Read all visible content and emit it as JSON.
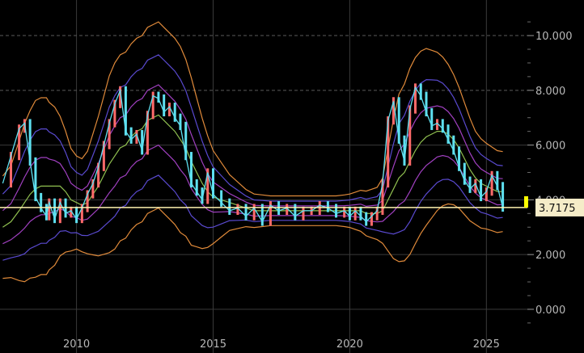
{
  "chart_data": {
    "type": "line",
    "title": "",
    "xlabel": "",
    "ylabel": "",
    "x_ticks": [
      "2010",
      "2015",
      "2020",
      "2025"
    ],
    "y_ticks": [
      "0.000",
      "2.000",
      "4.000",
      "6.000",
      "8.000",
      "10.000"
    ],
    "xlim": [
      2007.2,
      2026.5
    ],
    "ylim": [
      -0.8,
      11.3
    ],
    "grid": true,
    "legend": "none",
    "last_price_label": "3.7175",
    "last_price": 3.7175,
    "colors": {
      "background": "#000000",
      "grid": "#3a3a3a",
      "grid_dashed": "#5a5a5a",
      "price_up": "#ff6a6a",
      "price_line": "#5ee0f0",
      "last_price_line": "#fff2b0",
      "last_price_tag": "#f5ecc8",
      "last_price_marker": "#ffff00",
      "ma_line": "#90c050",
      "band1": "#a040c0",
      "band2": "#5a4ad0",
      "band3": "#e08a3a"
    },
    "series": [
      {
        "role": "price",
        "x": [
          2007.3,
          2007.6,
          2007.9,
          2008.1,
          2008.3,
          2008.5,
          2008.7,
          2008.9,
          2009.0,
          2009.2,
          2009.4,
          2009.6,
          2009.8,
          2010.0,
          2010.2,
          2010.4,
          2010.6,
          2010.8,
          2011.0,
          2011.2,
          2011.4,
          2011.6,
          2011.8,
          2012.0,
          2012.2,
          2012.4,
          2012.6,
          2012.8,
          2013.0,
          2013.2,
          2013.4,
          2013.6,
          2013.8,
          2014.0,
          2014.2,
          2014.4,
          2014.6,
          2014.8,
          2015.0,
          2015.3,
          2015.6,
          2015.9,
          2016.2,
          2016.5,
          2016.8,
          2017.1,
          2017.4,
          2017.7,
          2018.0,
          2018.3,
          2018.6,
          2018.9,
          2019.2,
          2019.5,
          2019.8,
          2020.0,
          2020.2,
          2020.4,
          2020.6,
          2020.8,
          2021.0,
          2021.2,
          2021.4,
          2021.6,
          2021.8,
          2022.0,
          2022.2,
          2022.4,
          2022.6,
          2022.8,
          2023.0,
          2023.2,
          2023.4,
          2023.6,
          2023.8,
          2024.0,
          2024.2,
          2024.4,
          2024.6,
          2024.8,
          2025.0,
          2025.2,
          2025.4,
          2025.6
        ],
        "values": [
          4.6,
          5.6,
          6.6,
          6.8,
          5.4,
          4.1,
          3.7,
          3.4,
          3.9,
          3.3,
          3.9,
          3.5,
          3.6,
          3.3,
          3.7,
          4.2,
          4.6,
          5.2,
          6.0,
          6.8,
          7.5,
          8.0,
          6.5,
          6.2,
          6.4,
          5.8,
          7.1,
          7.8,
          7.7,
          7.2,
          7.4,
          7.0,
          6.7,
          5.6,
          4.6,
          4.3,
          4.0,
          5.0,
          4.2,
          3.9,
          3.6,
          3.7,
          3.4,
          3.7,
          3.2,
          3.8,
          3.6,
          3.7,
          3.4,
          3.6,
          3.6,
          3.8,
          3.7,
          3.5,
          3.6,
          3.4,
          3.6,
          3.4,
          3.2,
          3.4,
          3.6,
          4.6,
          6.9,
          7.6,
          6.2,
          5.4,
          7.3,
          8.1,
          7.8,
          7.2,
          6.7,
          6.8,
          6.6,
          6.2,
          5.8,
          5.2,
          4.7,
          4.4,
          4.6,
          4.1,
          4.3,
          4.9,
          4.5,
          3.7175
        ]
      },
      {
        "role": "moving-average",
        "values": [
          3.0,
          3.2,
          3.6,
          3.9,
          4.2,
          4.4,
          4.5,
          4.5,
          4.5,
          4.5,
          4.5,
          4.3,
          4.0,
          3.9,
          3.8,
          3.9,
          4.2,
          4.5,
          4.9,
          5.3,
          5.6,
          5.9,
          6.0,
          6.3,
          6.5,
          6.6,
          6.9,
          7.0,
          7.1,
          6.9,
          6.7,
          6.5,
          6.2,
          5.9,
          5.4,
          5.0,
          4.6,
          4.3,
          4.1,
          4.0,
          3.9,
          3.8,
          3.7,
          3.6,
          3.6,
          3.6,
          3.6,
          3.6,
          3.6,
          3.6,
          3.6,
          3.6,
          3.6,
          3.6,
          3.6,
          3.6,
          3.6,
          3.6,
          3.5,
          3.5,
          3.5,
          3.6,
          4.0,
          4.4,
          4.8,
          5.0,
          5.4,
          5.8,
          6.1,
          6.3,
          6.4,
          6.5,
          6.5,
          6.4,
          6.2,
          5.9,
          5.5,
          5.1,
          4.8,
          4.6,
          4.5,
          4.4,
          4.3,
          4.3
        ]
      },
      {
        "role": "band-inner",
        "upper_offset": 1.1,
        "lower_offset": 1.1
      },
      {
        "role": "band-middle",
        "upper_offset": 2.2,
        "lower_offset": 2.2
      },
      {
        "role": "band-outer",
        "upper_offset": 3.4,
        "lower_offset": 3.4
      }
    ],
    "band_scale": [
      0.55,
      0.6,
      0.75,
      0.85,
      0.9,
      0.95,
      0.95,
      0.95,
      0.9,
      0.85,
      0.75,
      0.65,
      0.55,
      0.5,
      0.5,
      0.55,
      0.65,
      0.75,
      0.85,
      0.95,
      1.0,
      1.0,
      1.0,
      1.0,
      1.0,
      1.0,
      1.0,
      1.0,
      1.0,
      1.0,
      1.0,
      1.0,
      1.0,
      0.95,
      0.9,
      0.8,
      0.7,
      0.6,
      0.5,
      0.4,
      0.3,
      0.25,
      0.2,
      0.18,
      0.17,
      0.16,
      0.16,
      0.16,
      0.16,
      0.16,
      0.16,
      0.16,
      0.16,
      0.16,
      0.17,
      0.18,
      0.2,
      0.22,
      0.24,
      0.26,
      0.28,
      0.35,
      0.55,
      0.75,
      0.9,
      0.95,
      1.0,
      1.0,
      0.98,
      0.95,
      0.9,
      0.85,
      0.8,
      0.75,
      0.7,
      0.65,
      0.6,
      0.55,
      0.5,
      0.48,
      0.46,
      0.45,
      0.44,
      0.43
    ]
  }
}
